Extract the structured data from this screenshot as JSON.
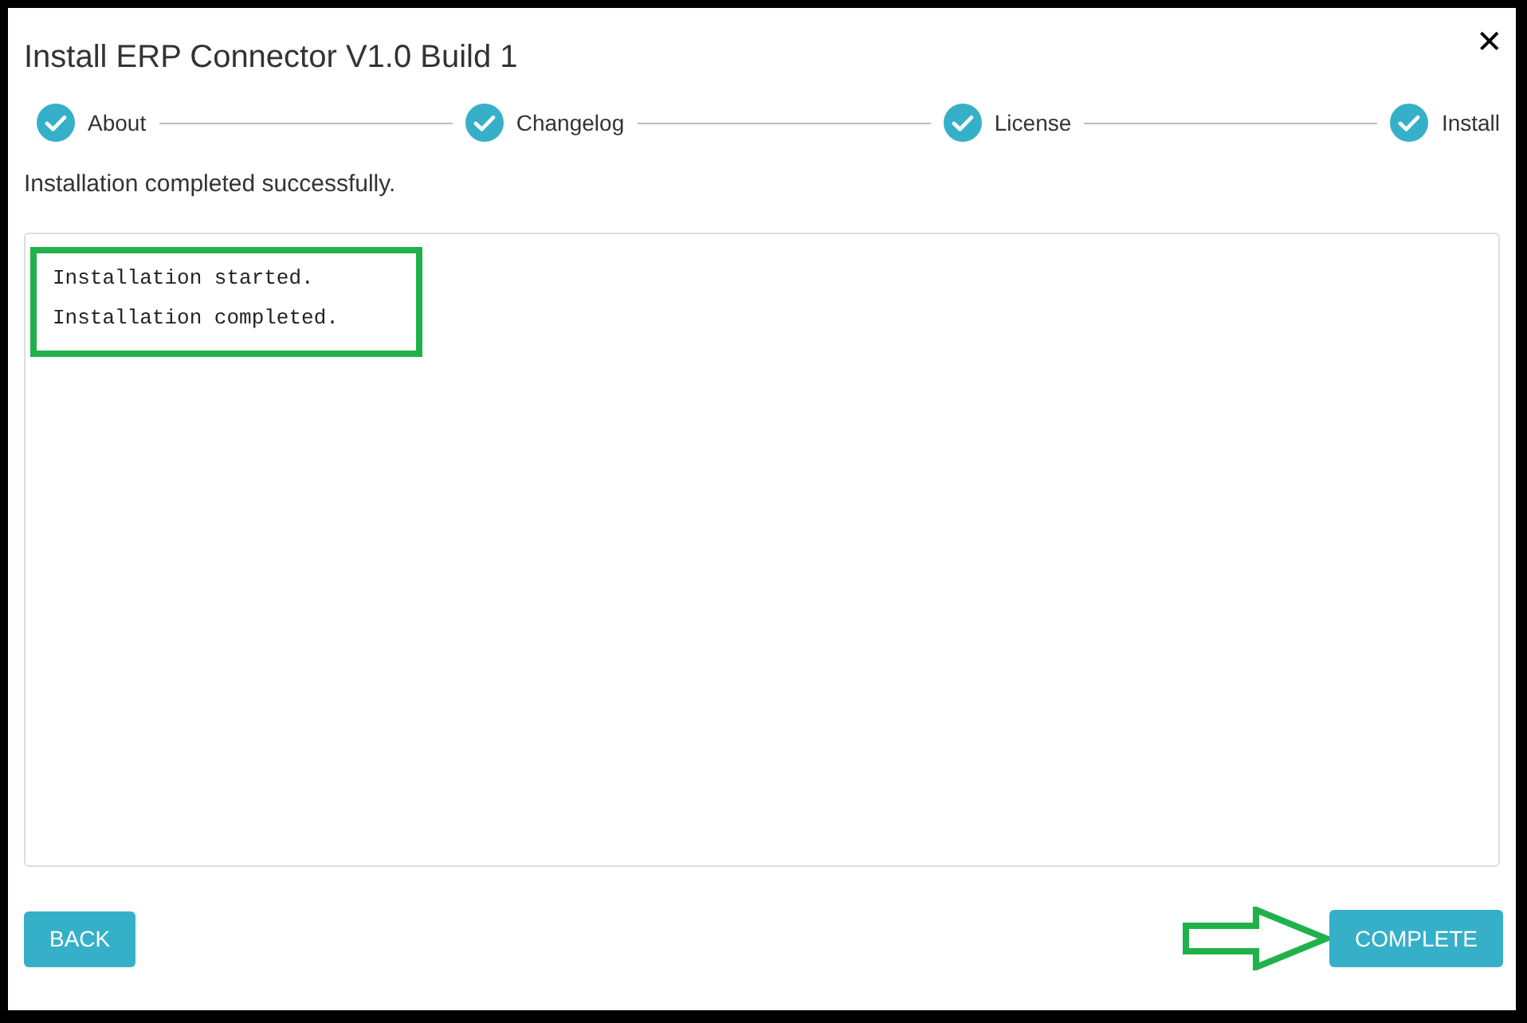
{
  "dialog": {
    "title": "Install ERP Connector V1.0 Build 1",
    "close": "✕"
  },
  "steps": [
    {
      "label": "About",
      "done": true
    },
    {
      "label": "Changelog",
      "done": true
    },
    {
      "label": "License",
      "done": true
    },
    {
      "label": "Install",
      "done": true
    }
  ],
  "message": "Installation completed successfully.",
  "log": [
    "Installation started.",
    "Installation completed."
  ],
  "buttons": {
    "back": "BACK",
    "complete": "COMPLETE"
  }
}
